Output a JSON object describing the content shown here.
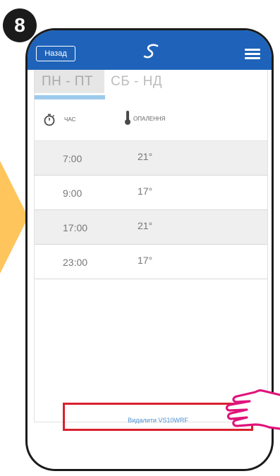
{
  "step": {
    "number": "8"
  },
  "header": {
    "back_label": "Назад",
    "logo_icon": "salus-logo-icon",
    "menu_icon": "hamburger-menu-icon",
    "color": "#1e63b9"
  },
  "tabs": [
    {
      "label": "ПН - ПТ",
      "active": true
    },
    {
      "label": "СБ - НД",
      "active": false
    }
  ],
  "table": {
    "col_time": "ЧАС",
    "col_heating": "ОПАЛЕННЯ",
    "rows": [
      {
        "time": "7:00",
        "temp": "21°"
      },
      {
        "time": "9:00",
        "temp": "17°"
      },
      {
        "time": "17:00",
        "temp": "21°"
      },
      {
        "time": "23:00",
        "temp": "17°"
      }
    ]
  },
  "actions": {
    "edit_icon": "pencil-icon",
    "delete_label": "Видалити VS10WRF"
  },
  "colors": {
    "accent": "#1e63b9",
    "highlight": "#d8202d",
    "pointer": "#fec55d",
    "hand_outline": "#e0147a"
  }
}
